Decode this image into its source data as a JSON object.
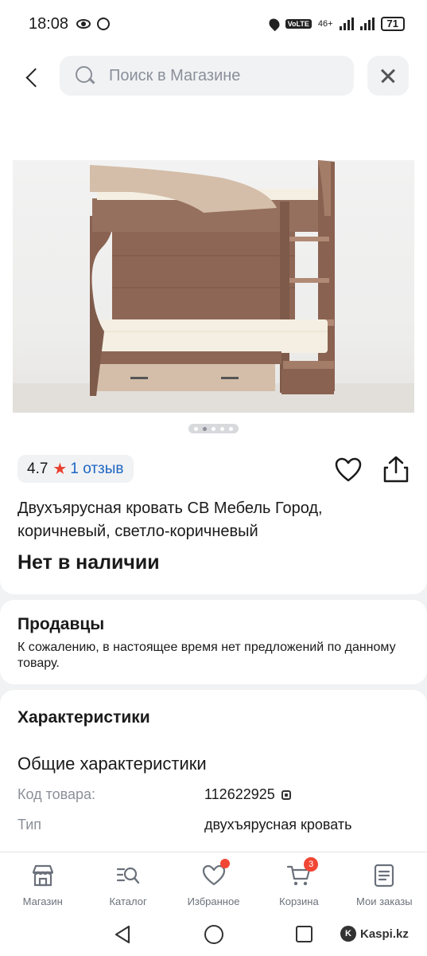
{
  "status_bar": {
    "time": "18:08",
    "network_label": "46+",
    "volte_label": "VoLTE",
    "battery": "71"
  },
  "search": {
    "placeholder": "Поиск в Магазине"
  },
  "product": {
    "rating": "4.7",
    "reviews": "1 отзыв",
    "title": "Двухъярусная кровать СВ Мебель Город, коричневый, светло-коричневый",
    "stock_status": "Нет в наличии",
    "image_count": 5,
    "active_image": 2
  },
  "sellers": {
    "title": "Продавцы",
    "message": "К сожалению, в настоящее время нет предложений по данному товару."
  },
  "specs": {
    "title": "Характеристики",
    "subtitle": "Общие характеристики",
    "rows": [
      {
        "label": "Код товара:",
        "value": "112622925"
      },
      {
        "label": "Тип",
        "value": "двухъярусная кровать"
      }
    ]
  },
  "bottom_nav": {
    "items": [
      {
        "label": "Магазин",
        "icon": "shop-icon"
      },
      {
        "label": "Каталог",
        "icon": "catalog-search-icon"
      },
      {
        "label": "Избранное",
        "icon": "heart-icon"
      },
      {
        "label": "Корзина",
        "icon": "cart-icon",
        "badge": "3"
      },
      {
        "label": "Мои заказы",
        "icon": "orders-icon"
      }
    ]
  },
  "watermark": "Kaspi.kz",
  "colors": {
    "accent_red": "#e8402f",
    "link_blue": "#1d66c2",
    "wood_dark": "#8a6251",
    "wood_light": "#cfb59f"
  }
}
